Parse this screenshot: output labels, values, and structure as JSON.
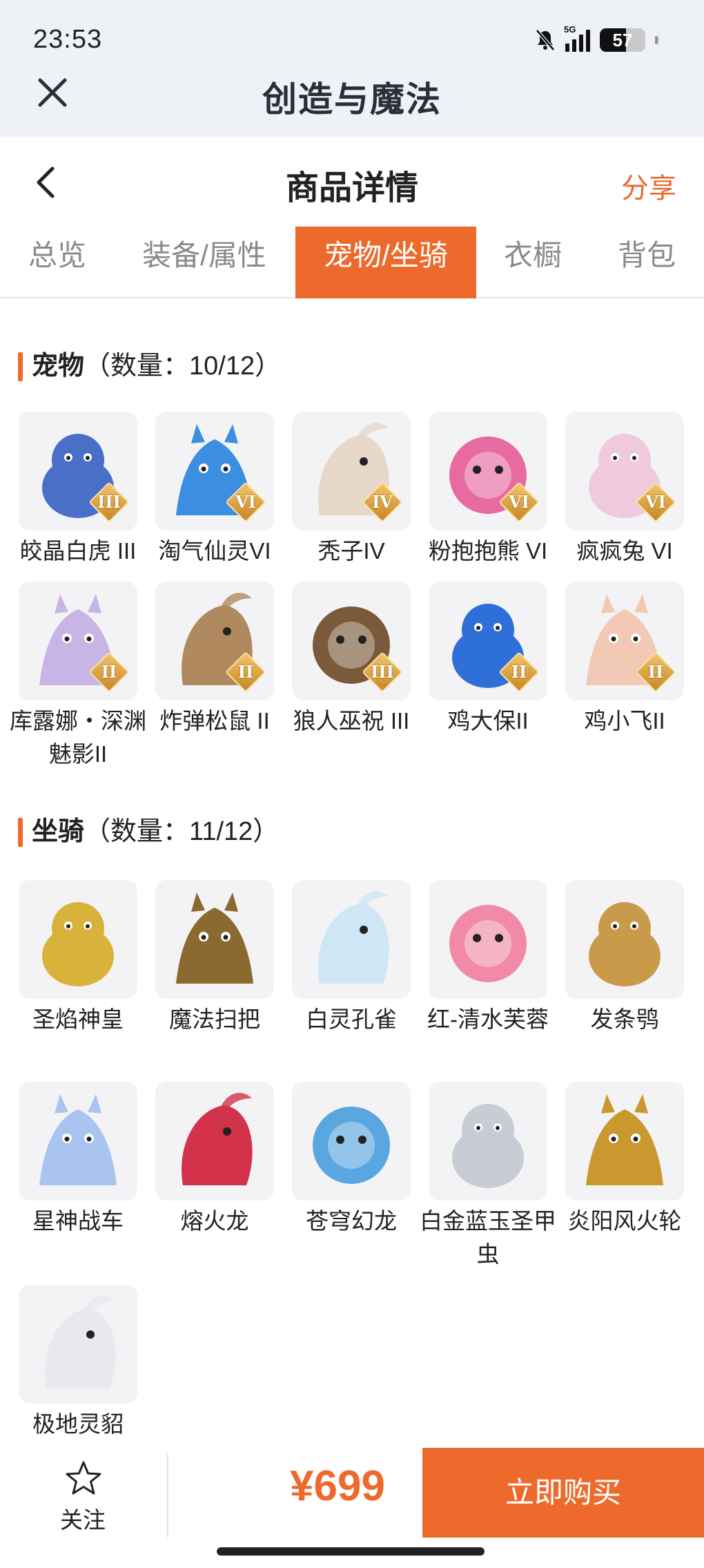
{
  "status": {
    "time": "23:53",
    "network": "5G",
    "battery": "57",
    "battery_level": 0.57
  },
  "app": {
    "title": "创造与魔法"
  },
  "header": {
    "title": "商品详情",
    "share_label": "分享"
  },
  "tabs": [
    {
      "label": "总览",
      "active": false
    },
    {
      "label": "装备/属性",
      "active": false
    },
    {
      "label": "宠物/坐骑",
      "active": true
    },
    {
      "label": "衣橱",
      "active": false
    },
    {
      "label": "背包",
      "active": false
    }
  ],
  "pets": {
    "title": "宠物",
    "count": "（数量：10/12）",
    "items": [
      {
        "name": "皎晶白虎 III",
        "grade": "III",
        "icon": "white-tiger-icon",
        "color": "#4a6fc9"
      },
      {
        "name": "淘气仙灵VI",
        "grade": "VI",
        "icon": "blue-dog-icon",
        "color": "#3b8ee0"
      },
      {
        "name": "秃子IV",
        "grade": "IV",
        "icon": "bald-kid-icon",
        "color": "#e6d8c8"
      },
      {
        "name": "粉抱抱熊 VI",
        "grade": "VI",
        "icon": "pink-bear-icon",
        "color": "#e76aa0"
      },
      {
        "name": "疯疯兔 VI",
        "grade": "VI",
        "icon": "bunny-icon",
        "color": "#f1c9dc"
      },
      {
        "name": "库露娜・深渊魅影II",
        "grade": "II",
        "icon": "phantom-girl-icon",
        "color": "#c9b4e6"
      },
      {
        "name": "炸弹松鼠 II",
        "grade": "II",
        "icon": "squirrel-icon",
        "color": "#b08a5e"
      },
      {
        "name": "狼人巫祝 III",
        "grade": "III",
        "icon": "werewolf-icon",
        "color": "#7a5a3a"
      },
      {
        "name": "鸡大保II",
        "grade": "II",
        "icon": "blue-chicken-icon",
        "color": "#2f6fd8"
      },
      {
        "name": "鸡小飞II",
        "grade": "II",
        "icon": "round-chick-icon",
        "color": "#f2c9b4"
      }
    ]
  },
  "mounts": {
    "title": "坐骑",
    "count": "（数量：11/12）",
    "items": [
      {
        "name": "圣焰神皇",
        "icon": "golden-phoenix-icon",
        "color": "#d8b23a"
      },
      {
        "name": "魔法扫把",
        "icon": "magic-broom-icon",
        "color": "#8a6a2e"
      },
      {
        "name": "白灵孔雀",
        "icon": "white-peacock-icon",
        "color": "#cfe6f5"
      },
      {
        "name": "红-清水芙蓉",
        "icon": "lotus-icon",
        "color": "#f08aa8"
      },
      {
        "name": "发条鸮",
        "icon": "clockwork-owl-icon",
        "color": "#c89a4a"
      },
      {
        "name": "星神战车",
        "icon": "star-chariot-icon",
        "color": "#a9c4f0"
      },
      {
        "name": "熔火龙",
        "icon": "lava-dragon-icon",
        "color": "#d2334a"
      },
      {
        "name": "苍穹幻龙",
        "icon": "sky-dragon-icon",
        "color": "#5aa6e0"
      },
      {
        "name": "白金蓝玉圣甲虫",
        "icon": "scarab-icon",
        "color": "#c8ccd4"
      },
      {
        "name": "炎阳风火轮",
        "icon": "fire-wheel-icon",
        "color": "#c9982e"
      },
      {
        "name": "极地灵貂",
        "icon": "polar-marten-icon",
        "color": "#e8e8ee"
      }
    ]
  },
  "bottom": {
    "follow_label": "关注",
    "price": "¥699",
    "buy_label": "立即购买"
  },
  "colors": {
    "accent": "#ee6a2c",
    "topbar": "#eef1f6"
  }
}
